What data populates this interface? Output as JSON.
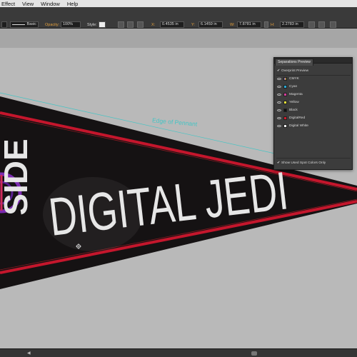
{
  "menu": {
    "items": [
      "Effect",
      "View",
      "Window",
      "Help"
    ]
  },
  "control_bar": {
    "stroke_style": "Basic",
    "opacity_label": "Opacity:",
    "opacity_value": "100%",
    "style_label": "Style:",
    "x_value": "0.4535 in",
    "y_value": "6.1459 in",
    "w_value": "7.8781 in",
    "h_value": "2.2783 in",
    "x_label": "X:",
    "y_label": "Y:",
    "w_label": "W:",
    "h_label": "H:"
  },
  "annotation": {
    "text": "Edge of Pennant"
  },
  "pennant": {
    "side_text": "SIDE",
    "main_text": "DIGITAL JEDI",
    "colors": {
      "body": "#151213",
      "stripe": "#c4162c",
      "text": "#e6e6e6",
      "emblem": "#7b2bb0"
    }
  },
  "separations_panel": {
    "title": "Separations Preview",
    "overprint_label": "Overprint Preview",
    "rows": [
      {
        "label": "CMYK",
        "color": ""
      },
      {
        "label": "Cyan",
        "color": "#2aa9d4"
      },
      {
        "label": "Magenta",
        "color": "#d43b9a"
      },
      {
        "label": "Yellow",
        "color": "#e8e13a"
      },
      {
        "label": "Black",
        "color": "#111111"
      },
      {
        "label": "DigitalRed",
        "color": "#d01c2c"
      },
      {
        "label": "Digital White",
        "color": "#f2f2f2"
      }
    ],
    "spot_only_label": "Show Used Spot Colors Only"
  },
  "colors": {
    "ui_dark": "#3a3a3a",
    "canvas_bg": "#b9b9b9",
    "accent_cyan": "#45c4c4"
  }
}
